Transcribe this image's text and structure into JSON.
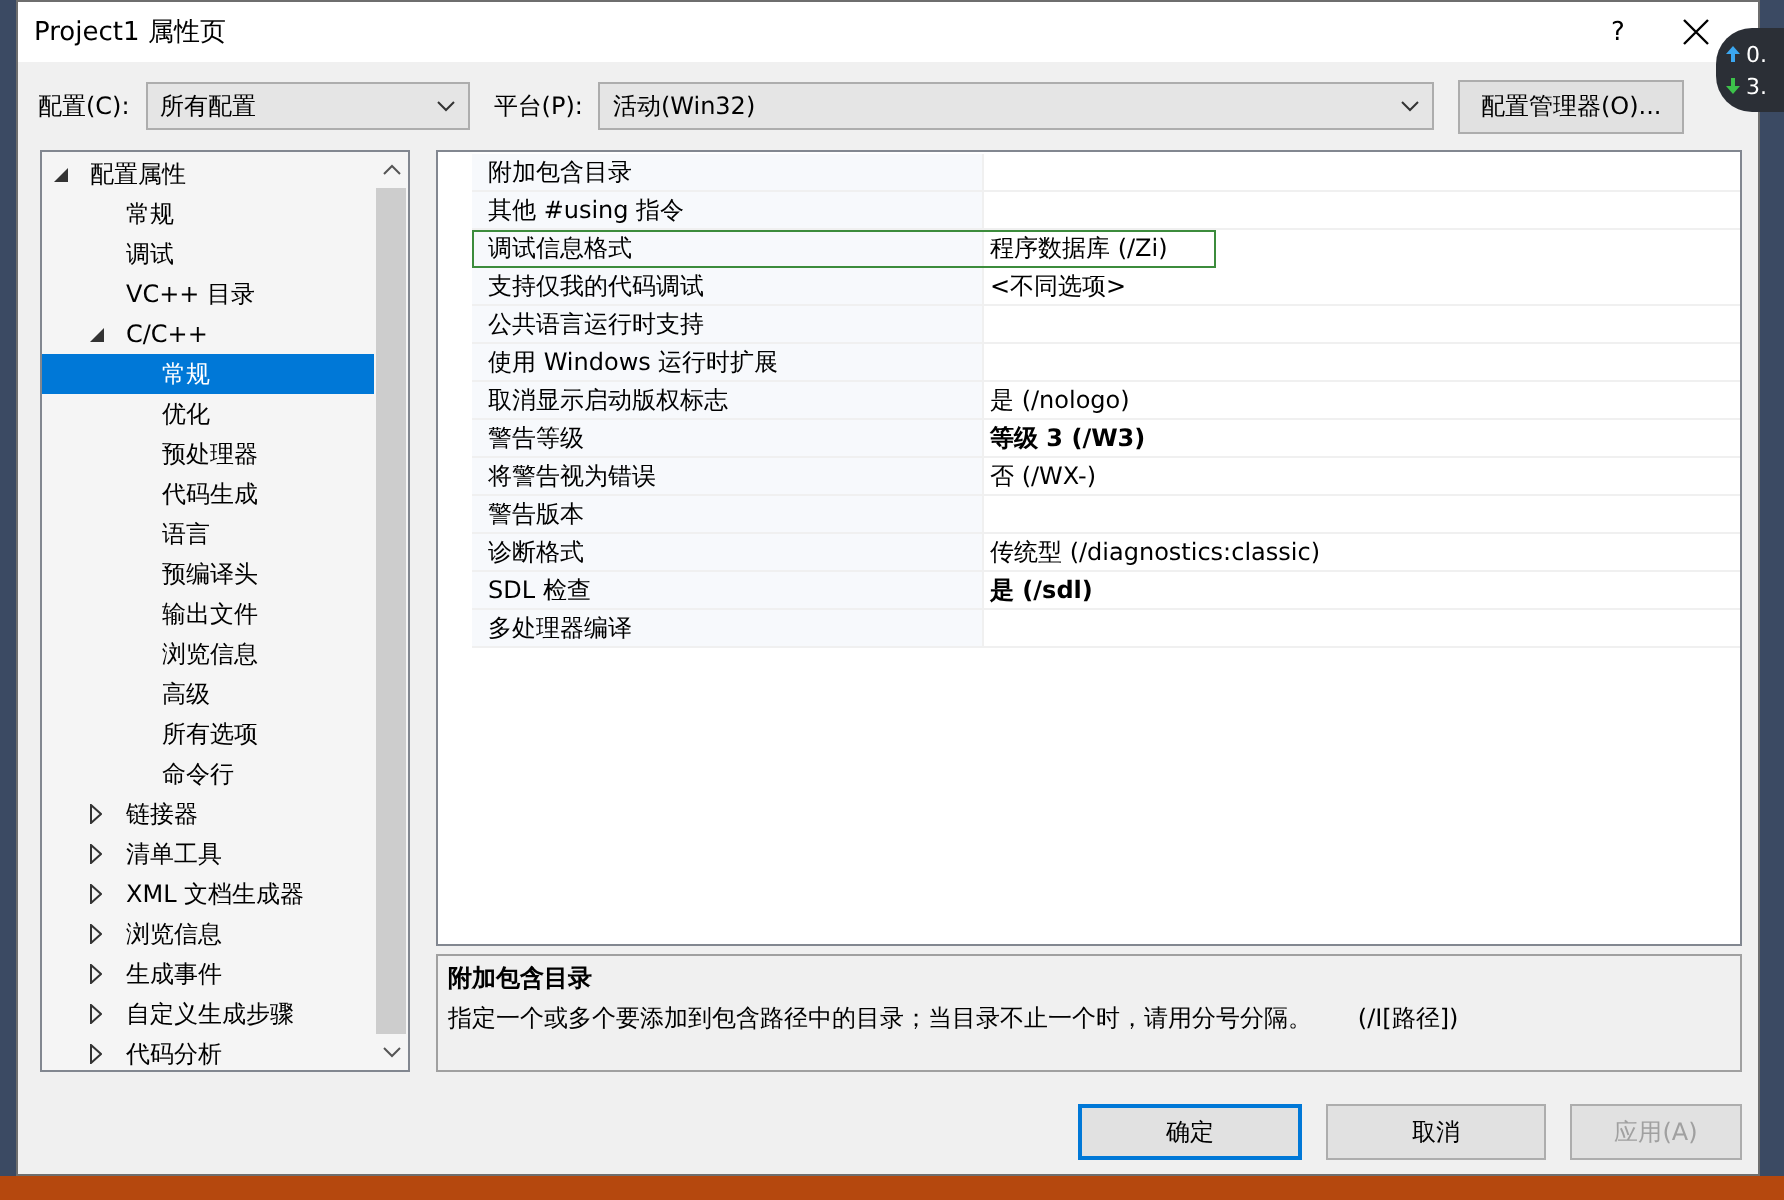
{
  "window": {
    "title": "Project1 属性页",
    "help": "?"
  },
  "config": {
    "label": "配置(C):",
    "value": "所有配置"
  },
  "platform": {
    "label": "平台(P):",
    "value": "活动(Win32)"
  },
  "config_manager": "配置管理器(O)...",
  "tree": [
    {
      "label": "配置属性",
      "expanded": true,
      "selected": false,
      "children": [
        {
          "label": "常规",
          "selected": false
        },
        {
          "label": "调试",
          "selected": false
        },
        {
          "label": "VC++ 目录",
          "selected": false
        },
        {
          "label": "C/C++",
          "expanded": true,
          "selected": false,
          "children": [
            {
              "label": "常规",
              "selected": true
            },
            {
              "label": "优化",
              "selected": false
            },
            {
              "label": "预处理器",
              "selected": false
            },
            {
              "label": "代码生成",
              "selected": false
            },
            {
              "label": "语言",
              "selected": false
            },
            {
              "label": "预编译头",
              "selected": false
            },
            {
              "label": "输出文件",
              "selected": false
            },
            {
              "label": "浏览信息",
              "selected": false
            },
            {
              "label": "高级",
              "selected": false
            },
            {
              "label": "所有选项",
              "selected": false
            },
            {
              "label": "命令行",
              "selected": false
            }
          ]
        },
        {
          "label": "链接器",
          "expanded": false,
          "selected": false
        },
        {
          "label": "清单工具",
          "expanded": false,
          "selected": false
        },
        {
          "label": "XML 文档生成器",
          "expanded": false,
          "selected": false
        },
        {
          "label": "浏览信息",
          "expanded": false,
          "selected": false
        },
        {
          "label": "生成事件",
          "expanded": false,
          "selected": false
        },
        {
          "label": "自定义生成步骤",
          "expanded": false,
          "selected": false
        },
        {
          "label": "代码分析",
          "expanded": false,
          "selected": false
        }
      ]
    }
  ],
  "properties": [
    {
      "name": "附加包含目录",
      "selected": false
    },
    {
      "name": "其他 #using 指令",
      "selected": false
    },
    {
      "name": "调试信息格式",
      "value": "程序数据库 (/Zi)",
      "bold": false,
      "selected": true
    },
    {
      "name": "支持仅我的代码调试",
      "value": "<不同选项>",
      "bold": false,
      "selected": false
    },
    {
      "name": "公共语言运行时支持",
      "selected": false
    },
    {
      "name": "使用 Windows 运行时扩展",
      "selected": false
    },
    {
      "name": "取消显示启动版权标志",
      "value": "是 (/nologo)",
      "bold": false,
      "selected": false
    },
    {
      "name": "警告等级",
      "value": "等级 3 (/W3)",
      "bold": true,
      "selected": false
    },
    {
      "name": "将警告视为错误",
      "value": "否 (/WX-)",
      "bold": false,
      "selected": false
    },
    {
      "name": "警告版本",
      "selected": false
    },
    {
      "name": "诊断格式",
      "value": "传统型 (/diagnostics:classic)",
      "bold": false,
      "selected": false
    },
    {
      "name": "SDL 检查",
      "value": "是 (/sdl)",
      "bold": true,
      "selected": false
    },
    {
      "name": "多处理器编译",
      "selected": false
    }
  ],
  "description": {
    "title": "附加包含目录",
    "text": "指定一个或多个要添加到包含路径中的目录；当目录不止一个时，请用分号分隔。      (/I[路径])"
  },
  "buttons": [
    {
      "label": "确定",
      "default": true,
      "disabled": false
    },
    {
      "label": "取消",
      "default": false,
      "disabled": false
    },
    {
      "label": "应用(A)",
      "default": false,
      "disabled": true
    }
  ],
  "net_speed": {
    "upload": "0.",
    "download": "3."
  }
}
